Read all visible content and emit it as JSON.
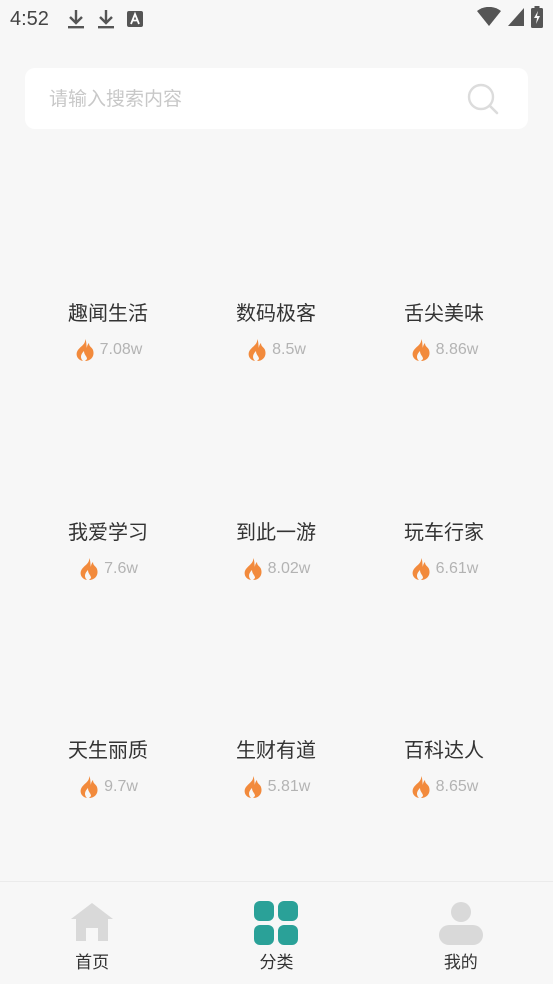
{
  "status_bar": {
    "time": "4:52",
    "icons": [
      "download-icon",
      "download-icon",
      "font-icon"
    ],
    "right_icons": [
      "wifi-icon",
      "signal-icon",
      "battery-charging-icon"
    ]
  },
  "search": {
    "placeholder": "请输入搜索内容",
    "value": ""
  },
  "categories": [
    {
      "title": "趣闻生活",
      "heat": "7.08w"
    },
    {
      "title": "数码极客",
      "heat": "8.5w"
    },
    {
      "title": "舌尖美味",
      "heat": "8.86w"
    },
    {
      "title": "我爱学习",
      "heat": "7.6w"
    },
    {
      "title": "到此一游",
      "heat": "8.02w"
    },
    {
      "title": "玩车行家",
      "heat": "6.61w"
    },
    {
      "title": "天生丽质",
      "heat": "9.7w"
    },
    {
      "title": "生财有道",
      "heat": "5.81w"
    },
    {
      "title": "百科达人",
      "heat": "8.65w"
    }
  ],
  "nav": {
    "items": [
      {
        "label": "首页",
        "icon": "home-icon",
        "active": false
      },
      {
        "label": "分类",
        "icon": "category-grid-icon",
        "active": true
      },
      {
        "label": "我的",
        "icon": "user-icon",
        "active": false
      }
    ]
  },
  "colors": {
    "background": "#f7f7f7",
    "accent": "#2aa198",
    "flame": "#f28a3c",
    "nav_inactive": "#d9d9d9",
    "muted_text": "#b3b3b3"
  }
}
